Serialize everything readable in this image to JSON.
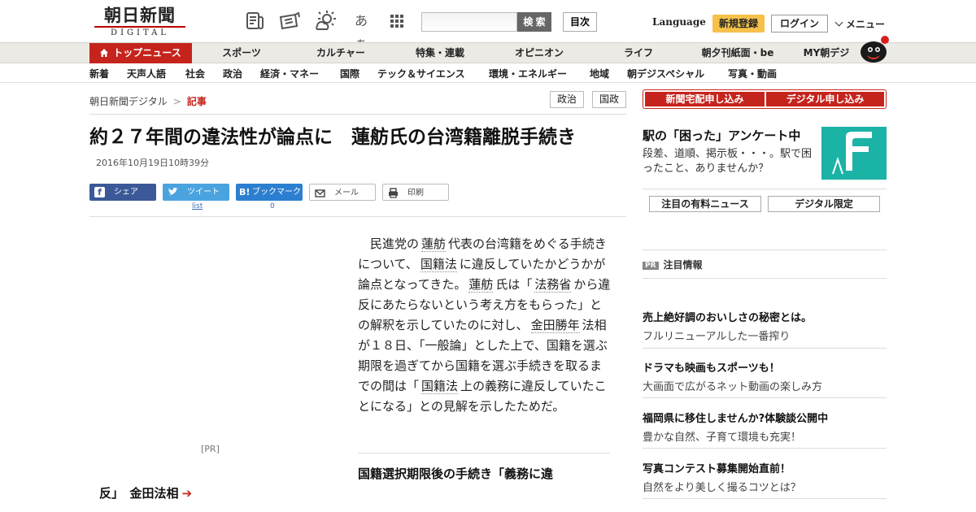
{
  "header": {
    "logo_main": "朝日新聞",
    "logo_sub": "DIGITAL",
    "font_size_icon_label": "あぁ",
    "search_button": "検 索",
    "toc_button": "目次",
    "language": "Language",
    "register": "新規登録",
    "login": "ログイン",
    "menu": "メニュー"
  },
  "nav_primary": [
    {
      "label": "トップニュース",
      "active": true
    },
    {
      "label": "スポーツ"
    },
    {
      "label": "カルチャー"
    },
    {
      "label": "特集・連載"
    },
    {
      "label": "オピニオン"
    },
    {
      "label": "ライフ"
    },
    {
      "label": "朝夕刊紙面・be"
    },
    {
      "label": "MY朝デジ"
    }
  ],
  "nav_secondary": [
    "新着",
    "天声人語",
    "社会",
    "政治",
    "経済・マネー",
    "国際",
    "テック＆サイエンス",
    "環境・エネルギー",
    "地域",
    "朝デジスペシャル",
    "写真・動画"
  ],
  "breadcrumb": {
    "home": "朝日新聞デジタル",
    "separator": ">",
    "current": "記事"
  },
  "tags": [
    "政治",
    "国政"
  ],
  "article": {
    "headline": "約２７年間の違法性が論点に　蓮舫氏の台湾籍離脱手続き",
    "date": "2016年10月19日10時39分",
    "share": {
      "facebook": "シェア",
      "twitter": "ツイート",
      "twitter_count": "list",
      "hatena": "ブックマーク",
      "hatena_count": "0",
      "mail": "メール",
      "print": "印刷"
    },
    "body": [
      {
        "t": "　民進党の"
      },
      {
        "k": "蓮舫"
      },
      {
        "t": "代表の台湾籍をめぐる手続きについて、"
      },
      {
        "k": "国籍法"
      },
      {
        "t": "に違反していたかどうかが論点となってきた。"
      },
      {
        "k": "蓮舫"
      },
      {
        "t": "氏は「"
      },
      {
        "k": "法務省"
      },
      {
        "t": "から違反にあたらないという考え方をもらった」との解釈を示していたのに対し、"
      },
      {
        "k": "金田勝年"
      },
      {
        "t": "法相が１８日、「一般論」とした上で、国籍を選ぶ期限を過ぎてから国籍を選ぶ手続きを取るまでの間は「"
      },
      {
        "k": "国籍法"
      },
      {
        "t": "上の義務に違反していたことになる」との見解を示したためだ。"
      }
    ],
    "subhead": "国籍選択期限後の手続き「義務に違",
    "pr_label": "[PR]",
    "related": "反」　金田法相"
  },
  "sidebar": {
    "promo_paper": "新聞宅配申し込み",
    "promo_digital": "デジタル申し込み",
    "ad_title": "駅の「困った」アンケート中",
    "ad_desc": "段差、道順、掲示板・・・。駅で困ったこと、ありませんか？",
    "tab_paid": "注目の有料ニュース",
    "tab_digital": "デジタル限定",
    "pr_badge": "PR",
    "pr_heading": "注目情報",
    "pr_items": [
      {
        "title": "売上絶好調のおいしさの秘密とは。",
        "desc": "フルリニューアルした一番搾り"
      },
      {
        "title": "ドラマも映画もスポーツも！",
        "desc": "大画面で広がるネット動画の楽しみ方"
      },
      {
        "title": "福岡県に移住しませんか?体験談公開中",
        "desc": "豊かな自然、子育て環境も充実！"
      },
      {
        "title": "写真コンテスト募集開始直前！",
        "desc": "自然をより美しく撮るコツとは？"
      }
    ]
  },
  "colors": {
    "accent": "#c5241c",
    "register": "#f6c14b",
    "facebook": "#3b5998",
    "twitter": "#4aa3df",
    "hatena": "#2c7fd0",
    "ad_logo": "#1bb3a6"
  },
  "icons": [
    "newspaper-icon",
    "ticket-icon",
    "weather-icon",
    "font-size-icon",
    "grid-icon",
    "home-icon",
    "mail-icon",
    "print-icon",
    "arrow-right-icon",
    "chevron-down-icon"
  ]
}
